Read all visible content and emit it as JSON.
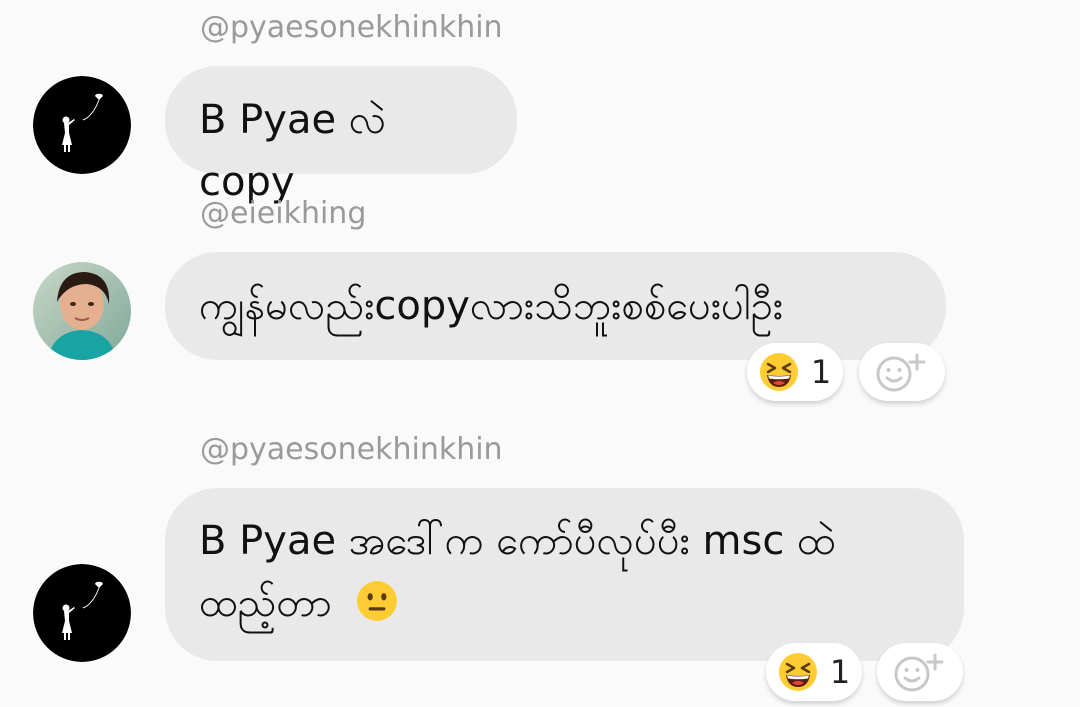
{
  "messages": [
    {
      "username": "@pyaesonekhinkhin",
      "text": "B Pyae လဲ copy",
      "avatar_icon": "girl-with-balloon-icon"
    },
    {
      "username": "@eieikhing",
      "text": "ကျွန်မလည်းcopyလားသိဘူးစစ်ပေးပါဦး",
      "avatar_icon": "profile-photo",
      "reaction": {
        "emoji": "grinning-squinting-face-icon",
        "count": "1"
      }
    },
    {
      "username": "@pyaesonekhinkhin",
      "text_line1": "B Pyae အဒေါ်က ကော်ပီလုပ်ပီး msc ထဲ",
      "text_line2": "ထည့်တာ",
      "inline_emoji": "neutral-face-icon",
      "avatar_icon": "girl-with-balloon-icon",
      "reaction": {
        "emoji": "grinning-squinting-face-icon",
        "count": "1"
      }
    }
  ],
  "colors": {
    "background": "#fafafa",
    "bubble": "#e9e9e9",
    "username": "#9a9a9a",
    "text": "#111111",
    "emoji_yellow": "#ffcc33"
  }
}
